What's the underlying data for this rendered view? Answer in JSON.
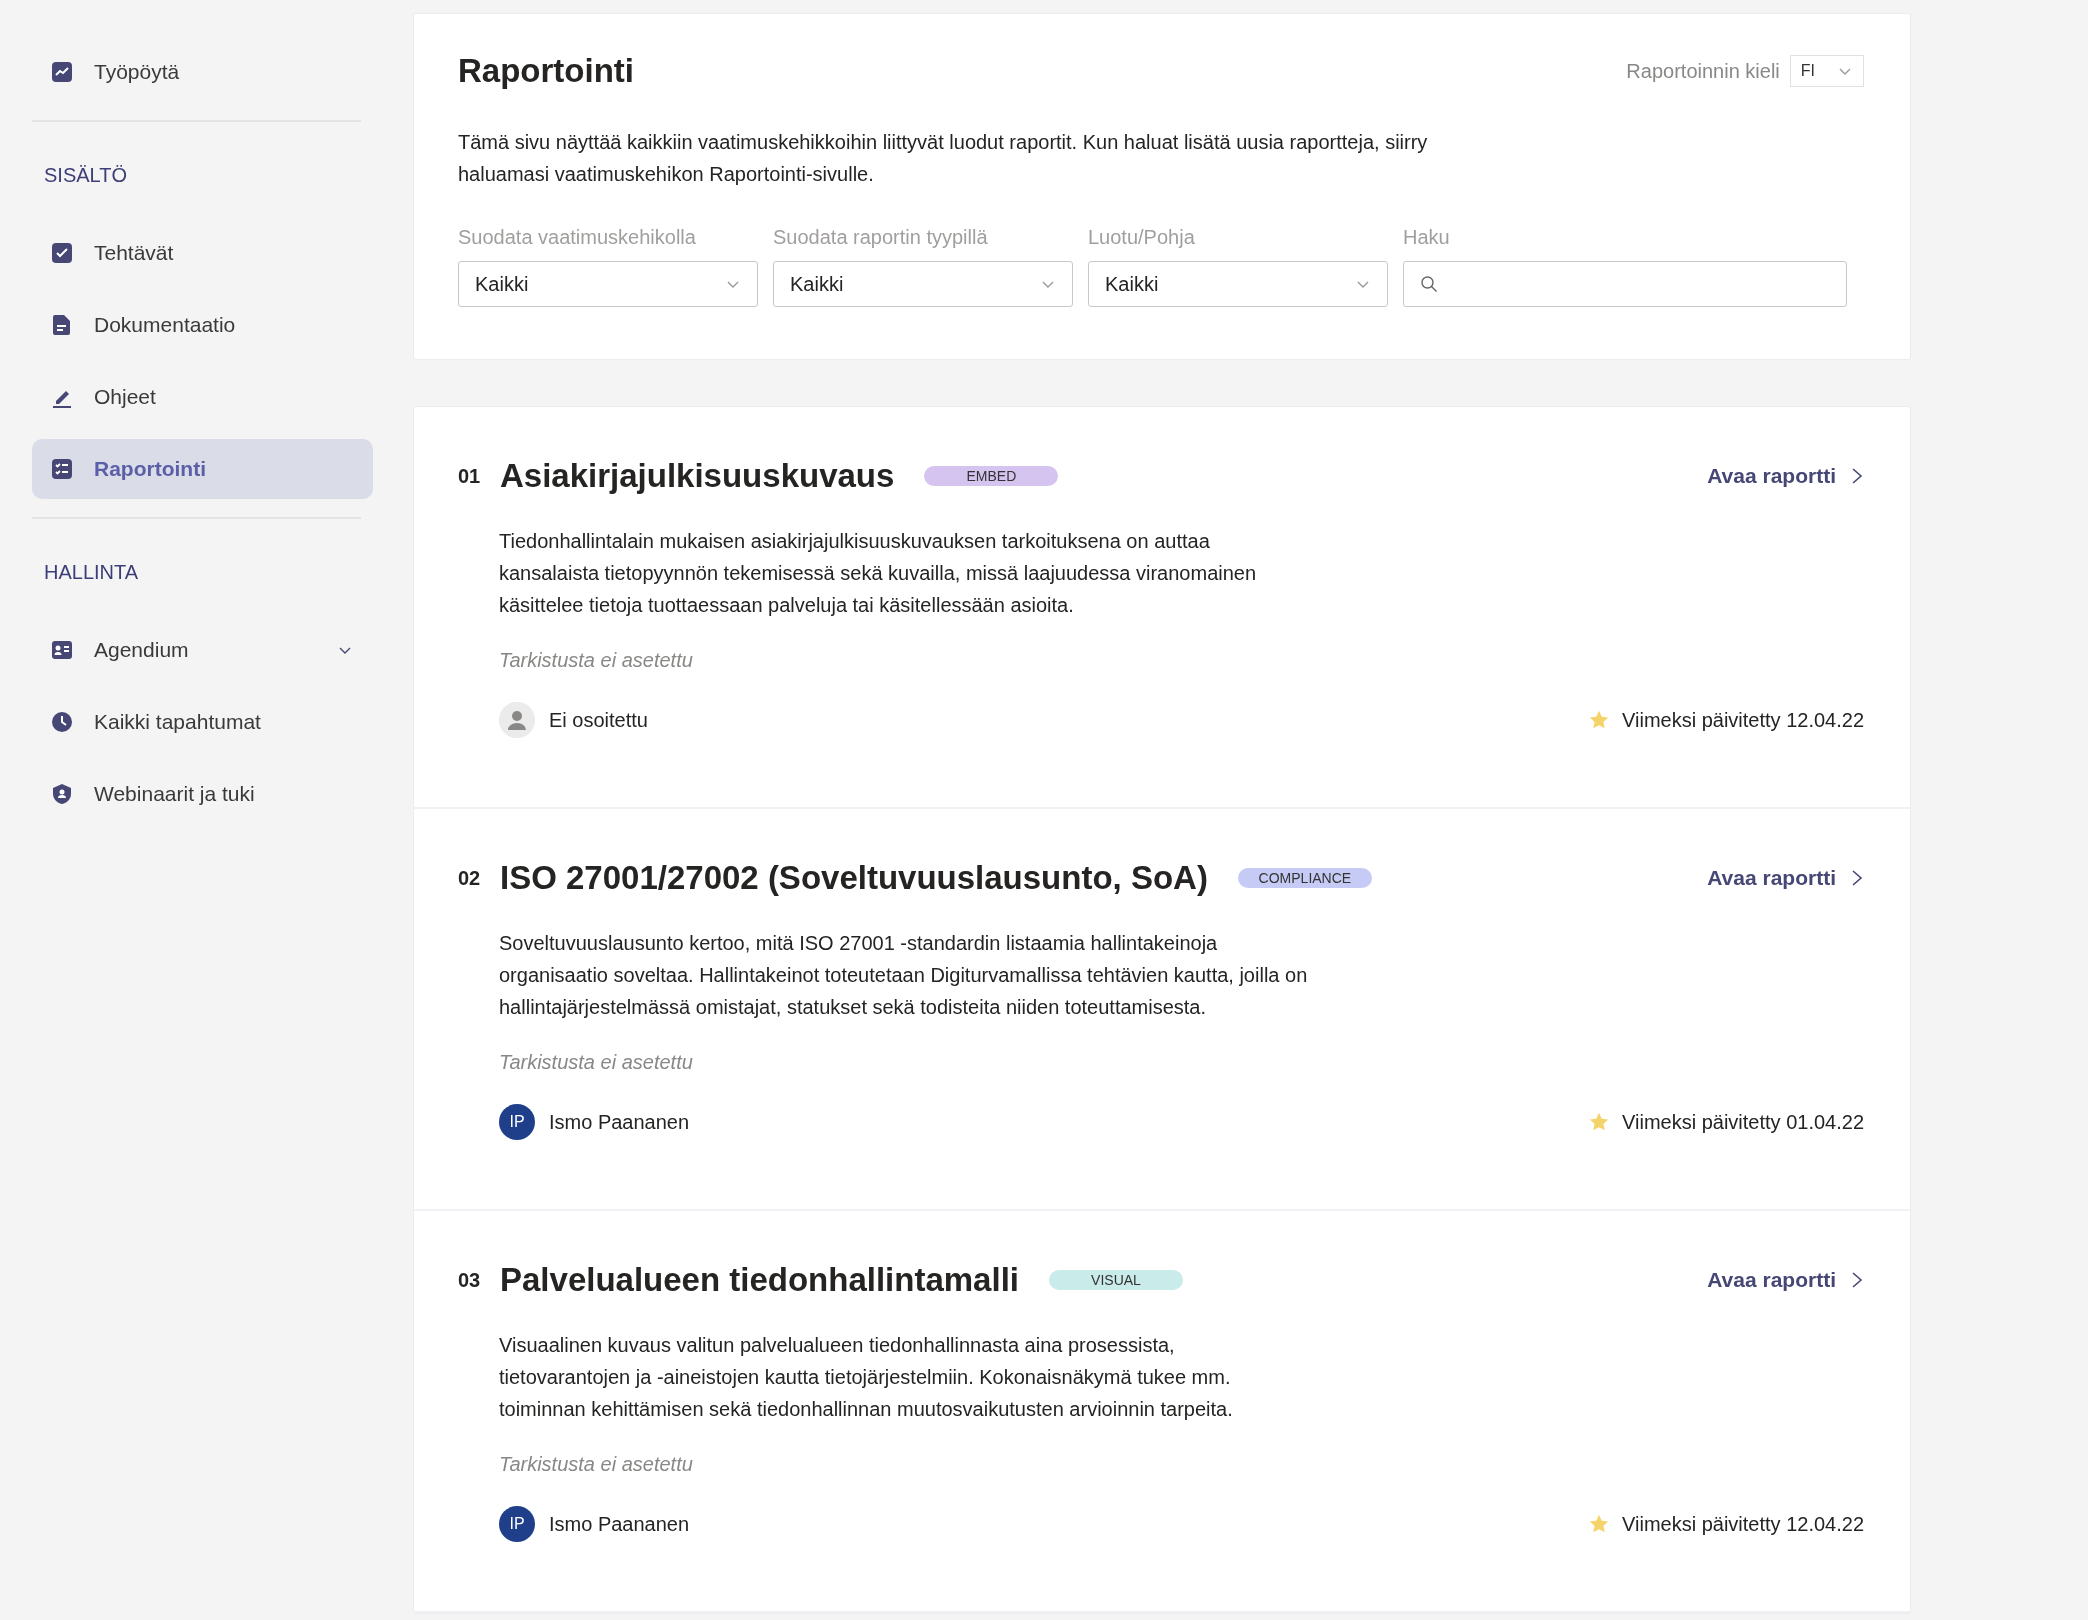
{
  "sidebar": {
    "top_items": [
      {
        "label": "Työpöytä",
        "selected": false
      }
    ],
    "sections": [
      {
        "heading": "SISÄLTÖ",
        "items": [
          {
            "label": "Tehtävät",
            "selected": false
          },
          {
            "label": "Dokumentaatio",
            "selected": false
          },
          {
            "label": "Ohjeet",
            "selected": false
          },
          {
            "label": "Raportointi",
            "selected": true
          }
        ]
      },
      {
        "heading": "HALLINTA",
        "items": [
          {
            "label": "Agendium",
            "selected": false,
            "expanded": false
          },
          {
            "label": "Kaikki tapahtumat",
            "selected": false
          },
          {
            "label": "Webinaarit ja tuki",
            "selected": false
          }
        ]
      }
    ]
  },
  "header": {
    "title": "Raportointi",
    "language_label": "Raportoinnin kieli",
    "language_value": "FI",
    "description": "Tämä sivu näyttää kaikkiin vaatimuskehikkoihin liittyvät luodut raportit. Kun haluat lisätä uusia raportteja, siirry haluamasi vaatimuskehikon Raportointi-sivulle.",
    "filters": [
      {
        "label": "Suodata vaatimuskehikolla",
        "value": "Kaikki"
      },
      {
        "label": "Suodata raportin tyypillä",
        "value": "Kaikki"
      },
      {
        "label": "Luotu/Pohja",
        "value": "Kaikki"
      }
    ],
    "search": {
      "label": "Haku"
    }
  },
  "reports": [
    {
      "number": "01",
      "title": "Asiakirjajulkisuuskuvaus",
      "badge": {
        "text": "EMBED",
        "color": "#d5c4f0"
      },
      "link": "Avaa raportti",
      "description": "Tiedonhallintalain mukaisen asiakirjajulkisuuskuvauksen tarkoituksena on auttaa kansalaista tietopyynnön tekemisessä sekä kuvailla, missä laajuudessa viranomainen käsittelee tietoja tuottaessaan palveluja tai käsitellessään asioita.",
      "review": "Tarkistusta ei asetettu",
      "assignee": {
        "name": "Ei osoitettu"
      },
      "updated": "Viimeksi päivitetty 12.04.22"
    },
    {
      "number": "02",
      "title": "ISO 27001/27002 (Soveltuvuuslausunto, SoA)",
      "badge": {
        "text": "COMPLIANCE",
        "color": "#c5cbf5"
      },
      "link": "Avaa raportti",
      "description": "Soveltuvuuslausunto kertoo, mitä ISO 27001 -standardin listaamia hallintakeinoja organisaatio soveltaa. Hallintakeinot toteutetaan Digiturvamallissa tehtävien kautta, joilla on hallintajärjestelmässä omistajat, statukset sekä todisteita niiden toteuttamisesta.",
      "review": "Tarkistusta ei asetettu",
      "assignee": {
        "name": "Ismo Paananen",
        "initials": "IP"
      },
      "updated": "Viimeksi päivitetty 01.04.22"
    },
    {
      "number": "03",
      "title": "Palvelualueen tiedonhallintamalli",
      "badge": {
        "text": "VISUAL",
        "color": "#c9ecea"
      },
      "link": "Avaa raportti",
      "description": "Visuaalinen kuvaus valitun palvelualueen tiedonhallinnasta aina prosessista, tietovarantojen ja -aineistojen kautta tietojärjestelmiin. Kokonaisnäkymä tukee mm. toiminnan kehittämisen sekä tiedonhallinnan muutosvaikutusten arvioinnin tarpeita.",
      "review": "Tarkistusta ei asetettu",
      "assignee": {
        "name": "Ismo Paananen",
        "initials": "IP"
      },
      "updated": "Viimeksi päivitetty 12.04.22"
    }
  ]
}
